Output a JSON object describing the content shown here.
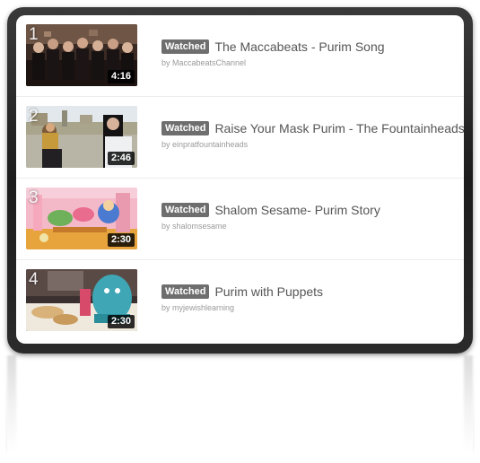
{
  "playlist": {
    "watched_label": "Watched",
    "items": [
      {
        "index": "1",
        "duration": "4:16",
        "title": "The Maccabeats - Purim Song",
        "author": "by MaccabeatsChannel",
        "thumbnail": "group-of-singers-thumbnail"
      },
      {
        "index": "2",
        "duration": "2:46",
        "title": "Raise Your Mask Purim - The Fountainheads",
        "author": "by einpratfountainheads",
        "thumbnail": "costumed-performers-thumbnail"
      },
      {
        "index": "3",
        "duration": "2:30",
        "title": "Shalom Sesame- Purim Story",
        "author": "by shalomsesame",
        "thumbnail": "puppet-stage-thumbnail"
      },
      {
        "index": "4",
        "duration": "2:30",
        "title": "Purim with Puppets",
        "author": "by myjewishlearning",
        "thumbnail": "puppet-table-thumbnail"
      }
    ]
  },
  "colors": {
    "frame": "#222222",
    "badge": "#6e6e6e",
    "title_text": "#555555",
    "author_text": "#9a9a9a"
  }
}
